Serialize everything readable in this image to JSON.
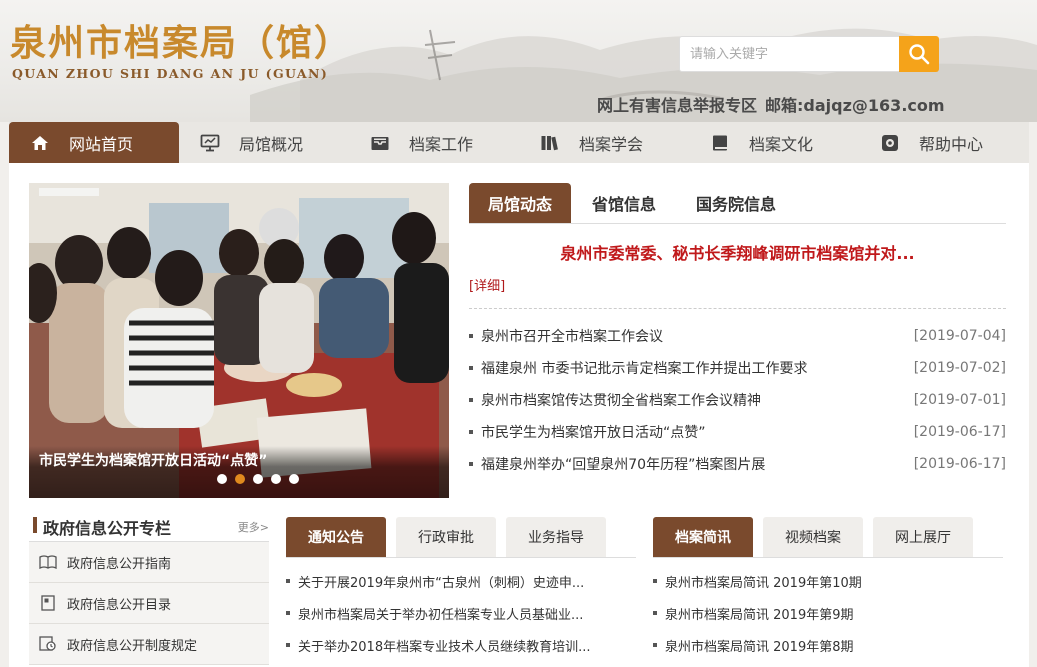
{
  "header": {
    "title_cn": "泉州市档案局（馆）",
    "title_en": "QUAN ZHOU SHI DANG AN JU (GUAN)",
    "search_placeholder": "请输入关键字",
    "report_label": "网上有害信息举报专区",
    "email_label": "邮箱:dajqz@163.com"
  },
  "nav": {
    "items": [
      {
        "label": "网站首页",
        "icon": "home-icon"
      },
      {
        "label": "局馆概况",
        "icon": "monitor-icon"
      },
      {
        "label": "档案工作",
        "icon": "inbox-icon"
      },
      {
        "label": "档案学会",
        "icon": "books-icon"
      },
      {
        "label": "档案文化",
        "icon": "book-icon"
      },
      {
        "label": "帮助中心",
        "icon": "help-icon"
      }
    ]
  },
  "slider": {
    "caption": "市民学生为档案馆开放日活动“点赞”",
    "active_index": 1,
    "count": 5
  },
  "news": {
    "tabs": [
      "局馆动态",
      "省馆信息",
      "国务院信息"
    ],
    "headline": "泉州市委常委、秘书长季翔峰调研市档案馆并对...",
    "detail_label": "[详细]",
    "items": [
      {
        "title": "泉州市召开全市档案工作会议",
        "date": "[2019-07-04]"
      },
      {
        "title": "福建泉州 市委书记批示肯定档案工作并提出工作要求",
        "date": "[2019-07-02]"
      },
      {
        "title": "泉州市档案馆传达贯彻全省档案工作会议精神",
        "date": "[2019-07-01]"
      },
      {
        "title": "市民学生为档案馆开放日活动“点赞”",
        "date": "[2019-06-17]"
      },
      {
        "title": "福建泉州举办“回望泉州70年历程”档案图片展",
        "date": "[2019-06-17]"
      }
    ]
  },
  "gov": {
    "title": "政府信息公开专栏",
    "more": "更多>",
    "items": [
      {
        "label": "政府信息公开指南",
        "icon": "open-book-icon"
      },
      {
        "label": "政府信息公开目录",
        "icon": "catalog-icon"
      },
      {
        "label": "政府信息公开制度规定",
        "icon": "regulation-icon"
      }
    ]
  },
  "notice": {
    "tabs": [
      "通知公告",
      "行政审批",
      "业务指导"
    ],
    "items": [
      "关于开展2019年泉州市“古泉州（刺桐）史迹申...",
      "泉州市档案局关于举办初任档案专业人员基础业...",
      "关于举办2018年档案专业技术人员继续教育培训..."
    ]
  },
  "brief": {
    "tabs": [
      "档案简讯",
      "视频档案",
      "网上展厅"
    ],
    "items": [
      "泉州市档案局简讯 2019年第10期",
      "泉州市档案局简讯 2019年第9期",
      "泉州市档案局简讯 2019年第8期"
    ]
  },
  "colors": {
    "brown": "#7a4a2d",
    "orange": "#f5a31a",
    "red": "#c0191b",
    "gold": "#c8892c"
  }
}
